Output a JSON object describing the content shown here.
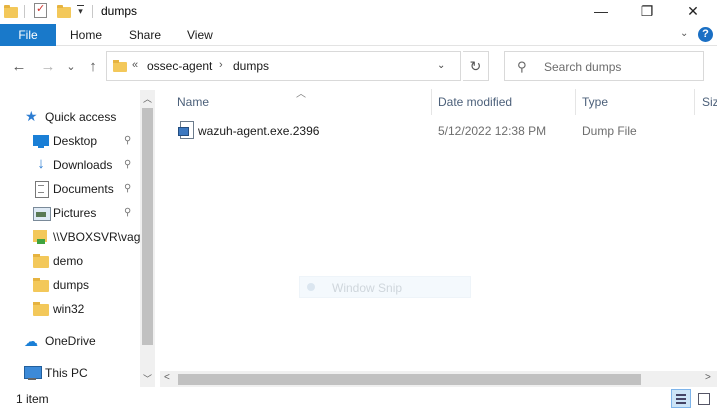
{
  "window": {
    "title": "dumps",
    "controls": {
      "minimize": "—",
      "maximize": "❐",
      "close": "✕"
    }
  },
  "ribbon": {
    "tabs": [
      "File",
      "Home",
      "Share",
      "View"
    ],
    "help": "?"
  },
  "nav": {
    "back": "←",
    "forward": "→",
    "recent": "⌄",
    "up": "↑",
    "address": {
      "overflow": "«",
      "crumbs": [
        "ossec-agent",
        "dumps"
      ],
      "separator": "›"
    },
    "refresh": "↻",
    "search_placeholder": "Search dumps"
  },
  "sidebar": {
    "items": [
      {
        "label": "Quick access",
        "icon": "star-icon",
        "pinned": false
      },
      {
        "label": "Desktop",
        "icon": "desktop-icon",
        "pinned": true
      },
      {
        "label": "Downloads",
        "icon": "download-icon",
        "pinned": true
      },
      {
        "label": "Documents",
        "icon": "documents-icon",
        "pinned": true
      },
      {
        "label": "Pictures",
        "icon": "pictures-icon",
        "pinned": true
      },
      {
        "label": "\\\\VBOXSVR\\vagrant",
        "icon": "network-folder-icon",
        "pinned": false
      },
      {
        "label": "demo",
        "icon": "folder-icon",
        "pinned": false
      },
      {
        "label": "dumps",
        "icon": "folder-icon",
        "pinned": false
      },
      {
        "label": "win32",
        "icon": "folder-icon",
        "pinned": false
      },
      {
        "label": "OneDrive",
        "icon": "cloud-icon",
        "pinned": false
      },
      {
        "label": "This PC",
        "icon": "computer-icon",
        "pinned": false
      }
    ],
    "pin_glyph": "📌"
  },
  "columns": [
    "Name",
    "Date modified",
    "Type",
    "Size"
  ],
  "files": [
    {
      "name": "wazuh-agent.exe.2396",
      "date": "5/12/2022 12:38 PM",
      "type": "Dump File",
      "size": ""
    }
  ],
  "overlay": {
    "text": "Window Snip"
  },
  "status": {
    "count": "1 item"
  },
  "colors": {
    "accent": "#1979ca",
    "header_text": "#4c607a",
    "folder": "#f3c85a"
  }
}
